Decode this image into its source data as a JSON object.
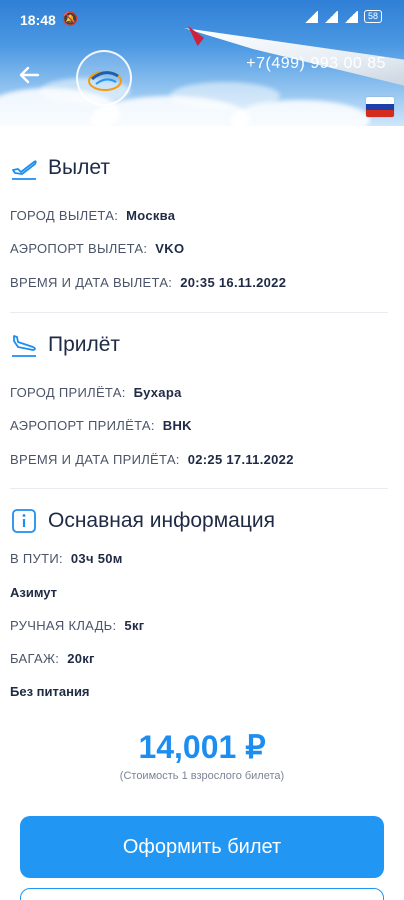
{
  "status": {
    "time": "18:48",
    "mute": "🔕",
    "battery": "58"
  },
  "header": {
    "phone": "+7(499) 993 00 85"
  },
  "departure": {
    "title": "Вылет",
    "city_label": "ГОРОД ВЫЛЕТА:",
    "city": "Москва",
    "airport_label": "АЭРОПОРТ ВЫЛЕТА:",
    "airport": "VKO",
    "datetime_label": "ВРЕМЯ И ДАТА ВЫЛЕТА:",
    "datetime": "20:35 16.11.2022"
  },
  "arrival": {
    "title": "Прилёт",
    "city_label": "ГОРОД ПРИЛЁТА:",
    "city": "Бухара",
    "airport_label": "АЭРОПОРТ ПРИЛЁТА:",
    "airport": "BHK",
    "datetime_label": "ВРЕМЯ И ДАТА ПРИЛЁТА:",
    "datetime": "02:25 17.11.2022"
  },
  "info": {
    "title": "Оснавная информация",
    "duration_label": "В ПУТИ:",
    "duration": "03ч 50м",
    "airline": "Азимут",
    "hand_luggage_label": "РУЧНАЯ КЛАДЬ:",
    "hand_luggage": "5кг",
    "baggage_label": "БАГАЖ:",
    "baggage": "20кг",
    "meal": "Без питания"
  },
  "price": {
    "amount": "14,001 ₽",
    "note": "(Стоимость 1 взрослого билета)"
  },
  "actions": {
    "book_label": "Оформить билет"
  },
  "colors": {
    "accent": "#2196f3",
    "price": "#1d8ef0",
    "flag": [
      "#ffffff",
      "#1c3fa8",
      "#d52b1e"
    ]
  }
}
